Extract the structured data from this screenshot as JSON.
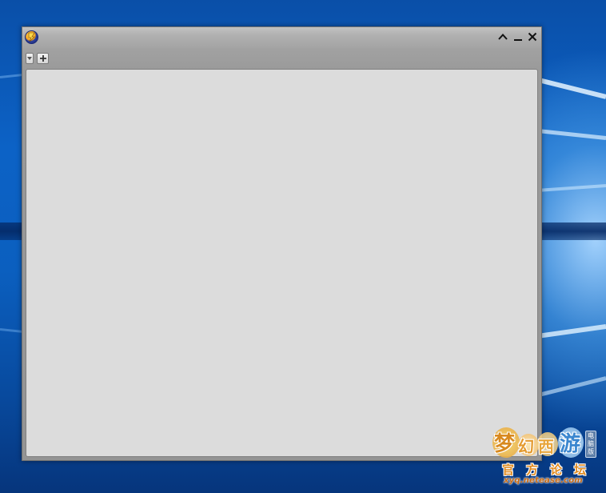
{
  "desktop": {
    "accent": "#0b5fbf"
  },
  "window": {
    "app_icon": "game-logo-icon",
    "controls": {
      "collapse_icon": "chevron-up-icon",
      "minimize_icon": "minimize-icon",
      "close_icon": "close-icon"
    },
    "toolbar": {
      "dropdown_icon": "chevron-down-icon",
      "add_icon": "plus-icon"
    },
    "content_background": "#dcdcdc"
  },
  "watermark": {
    "title_chars": [
      "梦",
      "幻",
      "西",
      "游"
    ],
    "edition": "电脑版",
    "subtitle_chars": [
      "官",
      "方",
      "论",
      "坛"
    ],
    "url": "xyq.netease.com"
  }
}
